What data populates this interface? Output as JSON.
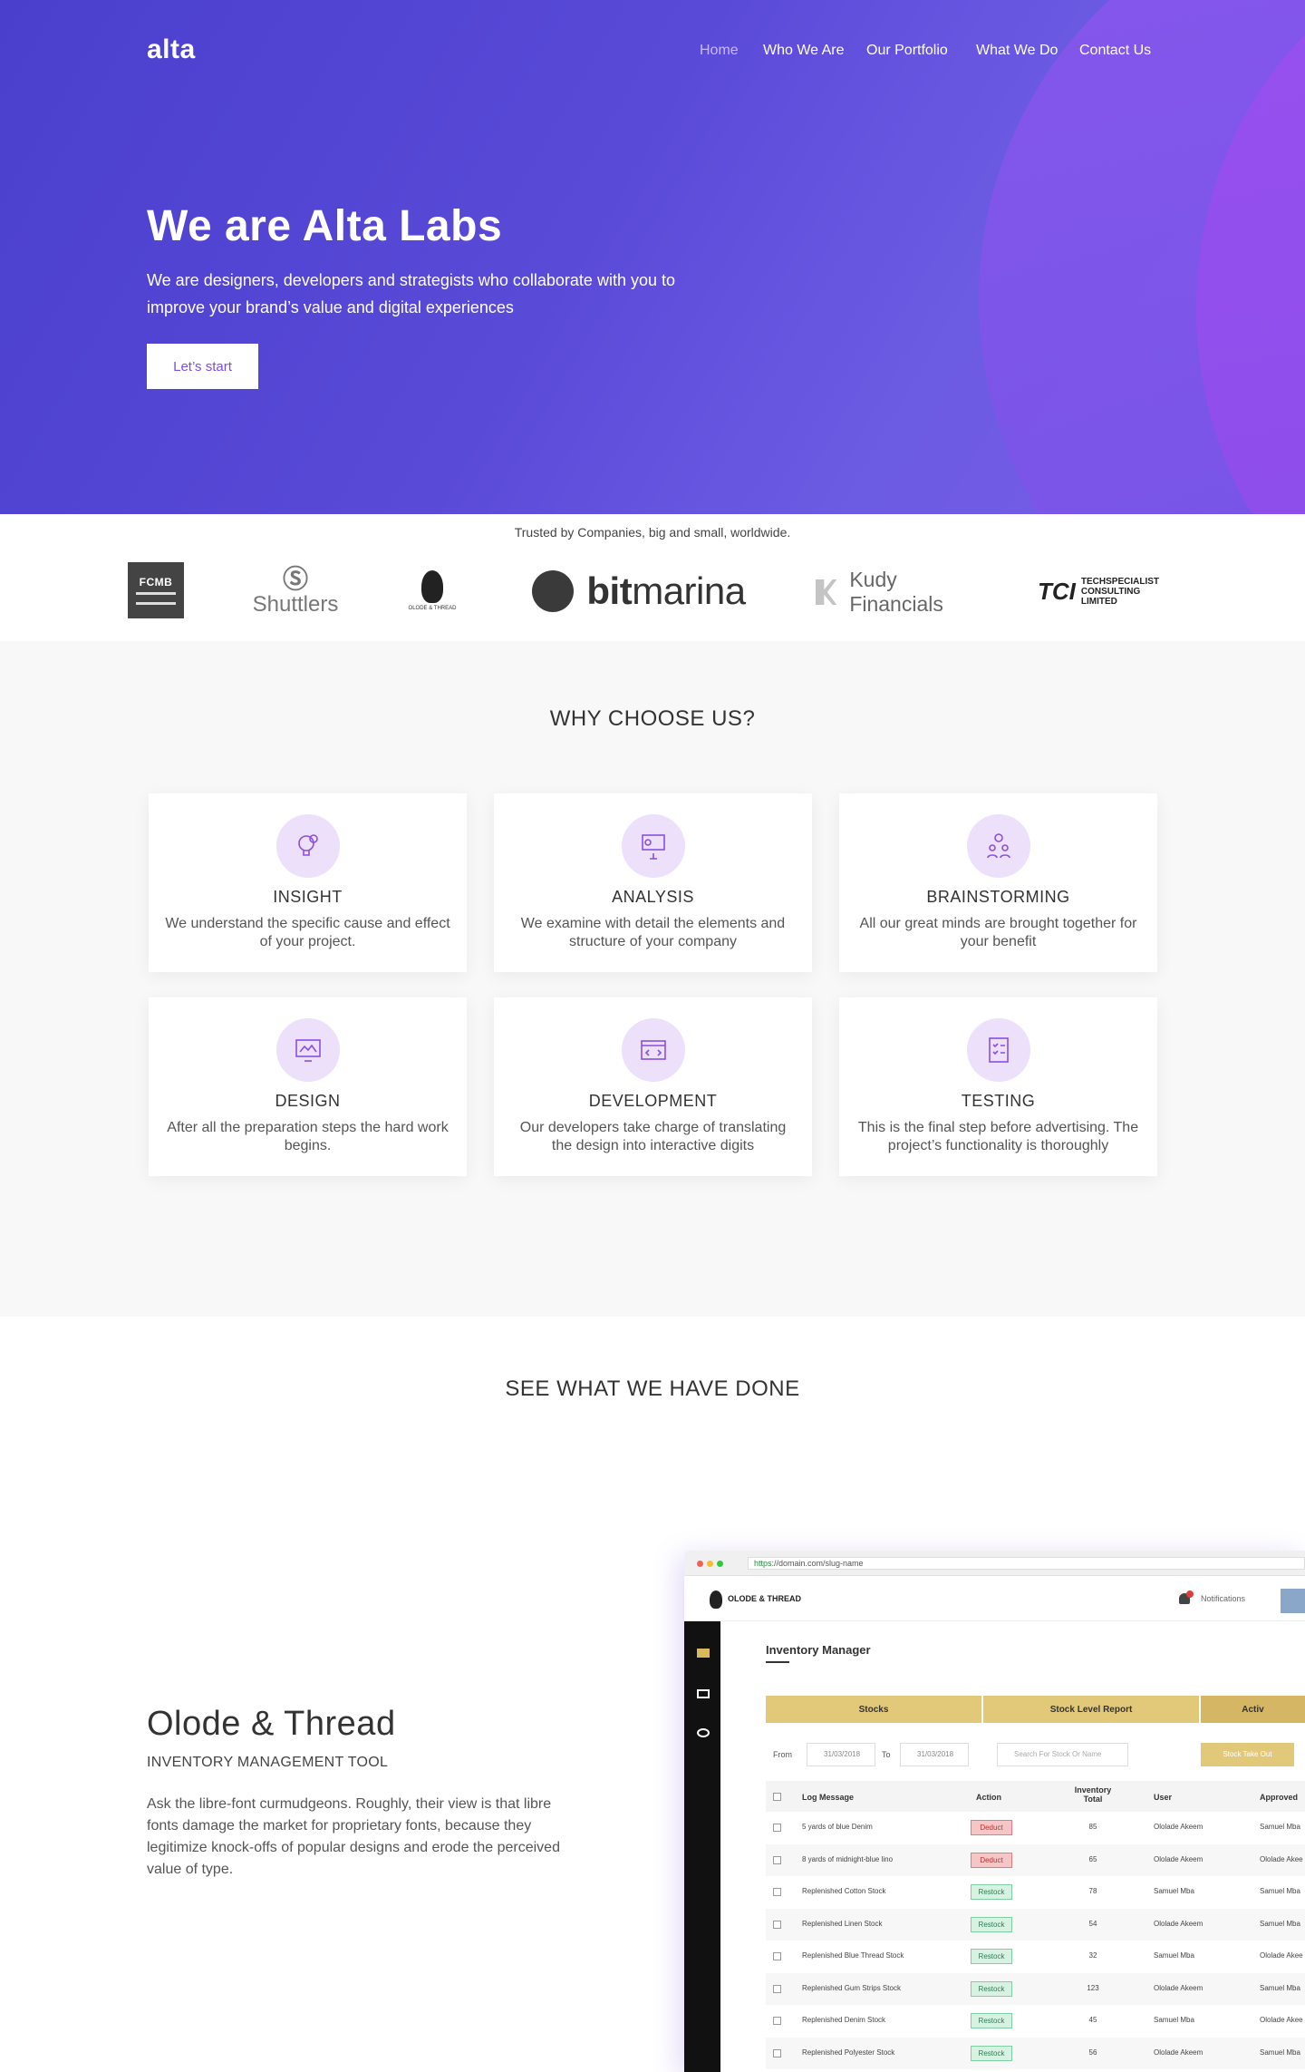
{
  "brand": "alta",
  "nav": [
    "Home",
    "Who We Are",
    "Our Portfolio",
    "What We Do",
    "Contact Us"
  ],
  "hero": {
    "title": "We are Alta Labs",
    "subtitle": "We are designers, developers and strategists who collaborate with you to improve your brand’s value and digital experiences",
    "cta": "Let’s start"
  },
  "trusted": {
    "text": "Trusted by Companies, big and small, worldwide.",
    "logos": {
      "fcmb": "FCMB",
      "shuttlers": "Shuttlers",
      "olode": "OLODE & THREAD",
      "bitmarina_bold": "bit",
      "bitmarina_light": "marina",
      "kudy": "Kudy Financials",
      "techs_mark": "TCI",
      "techs_name": "TECHSPECIALIST",
      "techs_sub": "CONSULTING LIMITED"
    }
  },
  "why": {
    "title": "WHY CHOOSE US?",
    "cards": [
      {
        "title": "INSIGHT",
        "desc": "We understand the specific cause and effect of your project.",
        "icon": "lightbulb-gear-icon"
      },
      {
        "title": "ANALYSIS",
        "desc": "We examine with detail the elements and structure of your company",
        "icon": "analysis-board-icon"
      },
      {
        "title": "BRAINSTORMING",
        "desc": "All our great minds are brought together for your benefit",
        "icon": "team-gear-icon"
      },
      {
        "title": "DESIGN",
        "desc": "After all the preparation steps the hard work begins.",
        "icon": "design-screen-icon"
      },
      {
        "title": "DEVELOPMENT",
        "desc": "Our developers take charge of translating the design into interactive digits",
        "icon": "code-browser-icon"
      },
      {
        "title": "TESTING",
        "desc": "This is the final step before advertising. The project’s functionality is thoroughly",
        "icon": "checklist-icon"
      }
    ]
  },
  "done": {
    "title": "SEE WHAT WE HAVE DONE",
    "project": {
      "name": "Olode & Thread",
      "type": "INVENTORY MANAGEMENT TOOL",
      "desc": "Ask the libre-font curmudgeons. Roughly, their view is that libre fonts damage the market for proprietary fonts, because they legitimize knock-offs of popular designs and erode the perceived value of type."
    }
  },
  "mockup": {
    "url_https": "https",
    "url_rest": "://domain.com/slug-name",
    "brand": "OLODE & THREAD",
    "notifications": "Notifications",
    "title": "Inventory Manager",
    "tabs": [
      "Stocks",
      "Stock Level Report",
      "Activ"
    ],
    "from_label": "From",
    "from_date": "31/03/2018",
    "to_label": "To",
    "to_date": "31/03/2018",
    "search_placeholder": "Search For Stock Or Name",
    "stock_out": "Stock Take Out",
    "columns": [
      "Log Message",
      "Action",
      "Inventory Total",
      "User",
      "Approved"
    ],
    "rows": [
      {
        "msg": "5 yards of blue Denim",
        "action": "Deduct",
        "total": "85",
        "user": "Ololade Akeem",
        "approved": "Samuel Mba"
      },
      {
        "msg": "8 yards of midnight-blue lino",
        "action": "Deduct",
        "total": "65",
        "user": "Ololade Akeem",
        "approved": "Ololade Akee"
      },
      {
        "msg": "Replenished Cotton Stock",
        "action": "Restock",
        "total": "78",
        "user": "Samuel Mba",
        "approved": "Samuel Mba"
      },
      {
        "msg": "Replenished Linen Stock",
        "action": "Restock",
        "total": "54",
        "user": "Ololade Akeem",
        "approved": "Samuel Mba"
      },
      {
        "msg": "Replenished Blue Thread Stock",
        "action": "Restock",
        "total": "32",
        "user": "Samuel Mba",
        "approved": "Ololade Akee"
      },
      {
        "msg": "Replenished Gum Strips Stock",
        "action": "Restock",
        "total": "123",
        "user": "Ololade Akeem",
        "approved": "Samuel Mba"
      },
      {
        "msg": "Replenished Denim Stock",
        "action": "Restock",
        "total": "45",
        "user": "Samuel Mba",
        "approved": "Ololade Akee"
      },
      {
        "msg": "Replenished Polyester Stock",
        "action": "Restock",
        "total": "56",
        "user": "Ololade Akeem",
        "approved": "Samuel Mba"
      }
    ]
  },
  "colors": {
    "hero_start": "#4a3fcd",
    "hero_end": "#8d55ee",
    "accent": "#7a4ee6",
    "gold": "#e2c97a"
  }
}
